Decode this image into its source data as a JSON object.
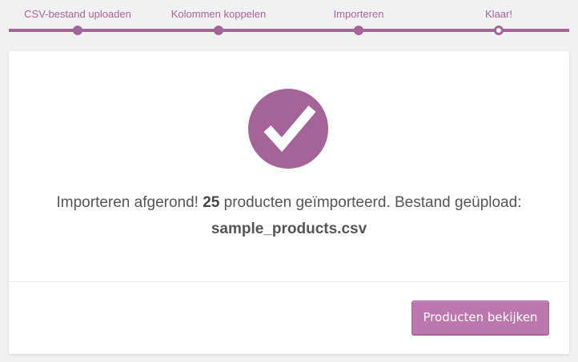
{
  "steps": [
    {
      "label": "CSV-bestand uploaden",
      "state": "done"
    },
    {
      "label": "Kolommen koppelen",
      "state": "done"
    },
    {
      "label": "Importeren",
      "state": "done"
    },
    {
      "label": "Klaar!",
      "state": "active"
    }
  ],
  "result": {
    "icon": "checkmark-icon",
    "message_prefix": "Importeren afgerond!",
    "count": "25",
    "message_suffix": "producten geïmporteerd. Bestand geüpload:",
    "filename": "sample_products.csv"
  },
  "actions": {
    "view_products_label": "Producten bekijken"
  },
  "colors": {
    "accent": "#a46497",
    "button": "#bb77ae",
    "background": "#f1f1f1",
    "card": "#ffffff"
  }
}
